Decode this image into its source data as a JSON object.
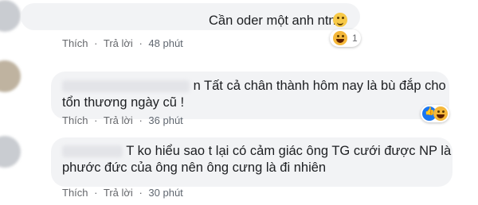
{
  "comments": [
    {
      "text": "Cần oder một anh ntn",
      "actions": {
        "like": "Thích",
        "reply": "Trả lời",
        "time": "48 phút"
      },
      "reactions": {
        "count": "1"
      }
    },
    {
      "text_line1": "n Tất cả chân thành hôm nay là bù đắp cho",
      "text_line2": "tổn thương ngày cũ !",
      "actions": {
        "like": "Thích",
        "reply": "Trả lời",
        "time": "36 phút"
      }
    },
    {
      "text_line1": "T ko hiểu sao t lại có cảm giác ông TG cưới được NP là",
      "text_line2": "phước đức của ông nên ông cưng là đi nhiên",
      "actions": {
        "like": "Thích",
        "reply": "Trả lời",
        "time": "30 phút"
      }
    }
  ],
  "separator": "·",
  "colors": {
    "bubble": "#f2f3f5",
    "meta": "#65676b",
    "like_blue": "#1877f2"
  }
}
